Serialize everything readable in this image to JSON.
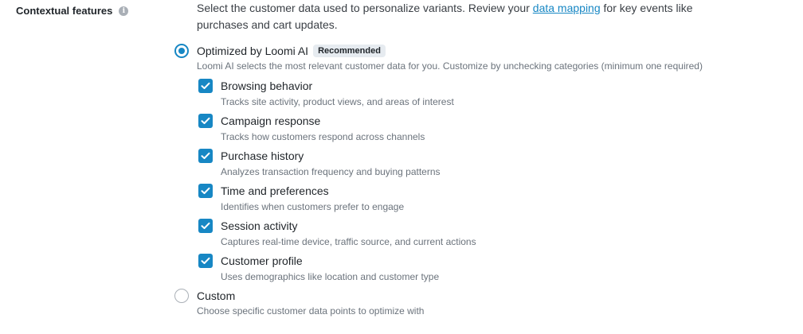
{
  "section": {
    "label": "Contextual features",
    "info_icon": "info-icon"
  },
  "description": {
    "part1": "Select the customer data used to personalize variants. Review your ",
    "link": "data mapping",
    "part2": " for key events like",
    "line2": "purchases and cart updates."
  },
  "options": {
    "optimized": {
      "label": "Optimized by Loomi AI",
      "badge": "Recommended",
      "help": "Loomi AI selects the most relevant customer data for you. Customize by unchecking categories (minimum one required)",
      "selected": true
    },
    "custom": {
      "label": "Custom",
      "help": "Choose specific customer data points to optimize with",
      "selected": false
    }
  },
  "categories": [
    {
      "label": "Browsing behavior",
      "help": "Tracks site activity, product views, and areas of interest",
      "checked": true
    },
    {
      "label": "Campaign response",
      "help": "Tracks how customers respond across channels",
      "checked": true
    },
    {
      "label": "Purchase history",
      "help": "Analyzes transaction frequency and buying patterns",
      "checked": true
    },
    {
      "label": "Time and preferences",
      "help": "Identifies when customers prefer to engage",
      "checked": true
    },
    {
      "label": "Session activity",
      "help": "Captures real-time device, traffic source, and current actions",
      "checked": true
    },
    {
      "label": "Customer profile",
      "help": "Uses demographics like location and customer type",
      "checked": true
    }
  ],
  "colors": {
    "accent": "#1787c4",
    "badge_bg": "#e6ebf0"
  }
}
